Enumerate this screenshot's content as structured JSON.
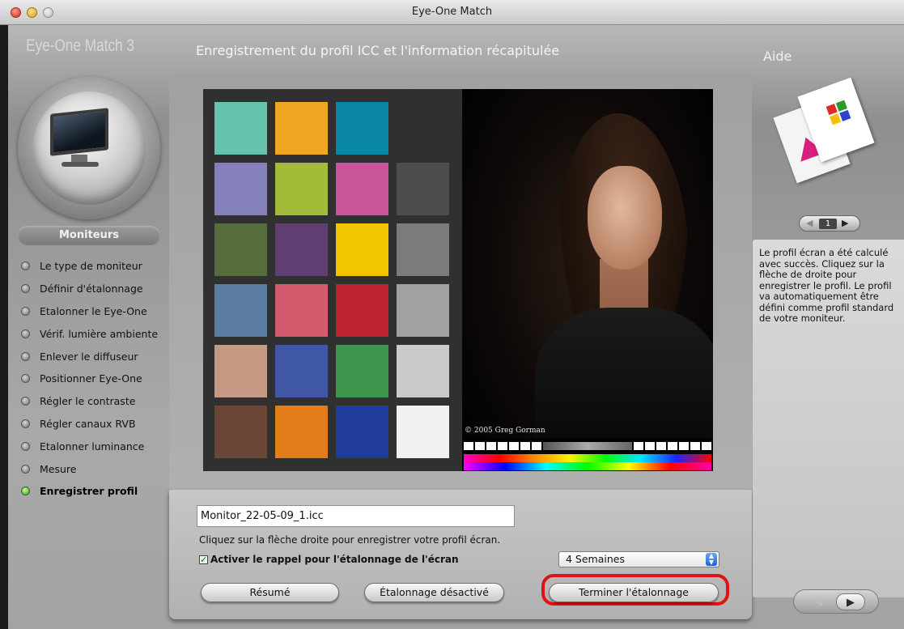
{
  "window": {
    "title": "Eye-One Match"
  },
  "app": {
    "brand": "Eye-One Match 3"
  },
  "header": {
    "title": "Enregistrement du profil ICC et l'information récapitulée"
  },
  "sidebar": {
    "section": "Moniteurs",
    "steps": [
      "Le type de moniteur",
      "Définir d'étalonnage",
      "Etalonner le Eye-One",
      "Vérif. lumière ambiente",
      "Enlever le diffuseur",
      "Positionner Eye-One",
      "Régler le contraste",
      "Régler canaux RVB",
      "Etalonner luminance",
      "Mesure",
      "Enregistrer profil"
    ],
    "active_index": 10
  },
  "preview": {
    "copyright": "© 2005 Greg Gorman",
    "patch_colors": [
      "#66c3ae",
      "#eea623",
      "#0b87a3",
      "#2f2f2f",
      "#8481ba",
      "#a2bb39",
      "#c8559a",
      "#4d4d4d",
      "#546d3a",
      "#5f3e74",
      "#f2c500",
      "#7b7b7b",
      "#5a7ca0",
      "#d35b6d",
      "#bd2433",
      "#a2a2a2",
      "#c69985",
      "#3f57a4",
      "#3f954b",
      "#c9c9c9",
      "#6b4637",
      "#e27d1a",
      "#1f3c9c",
      "#f1f1f1"
    ]
  },
  "bottom": {
    "filename": "Monitor_22-05-09_1.icc",
    "instruction": "Cliquez sur la flèche droite pour enregistrer votre profil écran.",
    "reminder_label": "Activer le rappel pour l'étalonnage de l'écran",
    "reminder_checked": true,
    "reminder_interval": "4 Semaines",
    "buttons": {
      "summary": "Résumé",
      "calibration_disabled": "Étalonnage désactivé",
      "finish": "Terminer l'étalonnage"
    }
  },
  "help": {
    "title": "Aide",
    "page": "1",
    "text": "Le profil écran a été calculé\navec succès. Cliquez sur la\nflèche de droite pour\nenregistrer le profil. Le profil\nva automatiquement être\ndéfini comme profil standard\nde votre moniteur."
  },
  "colors": {
    "highlight": "#e01212",
    "active_bullet": "#3c9b1c"
  }
}
